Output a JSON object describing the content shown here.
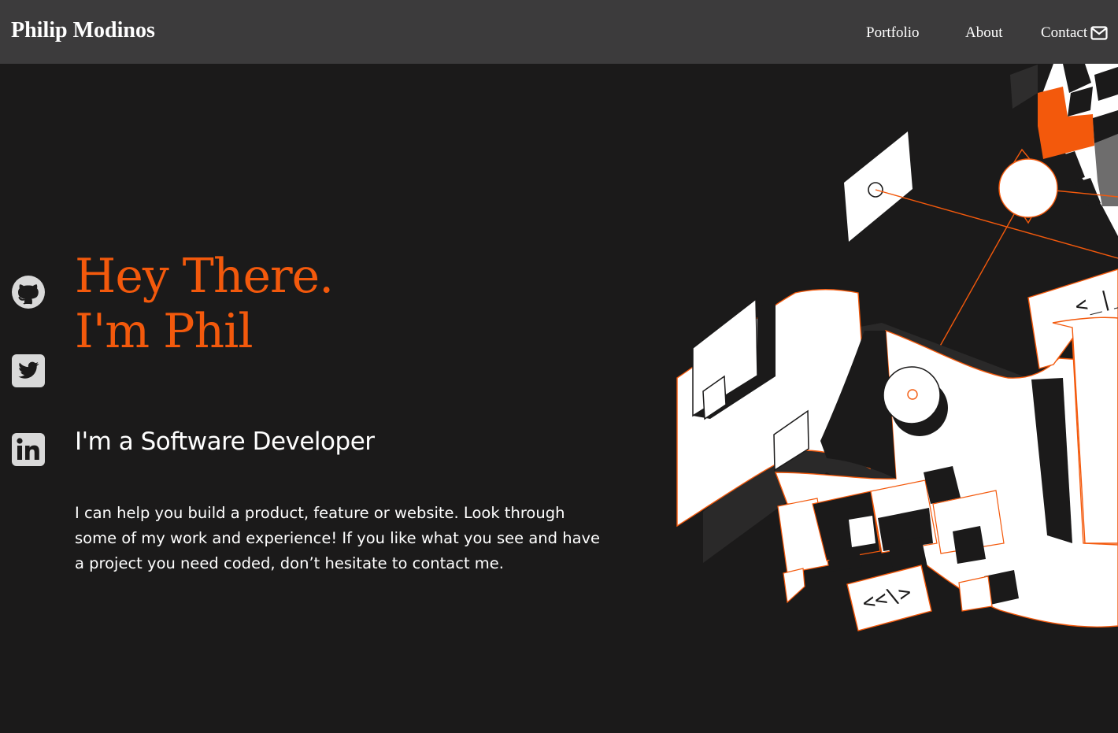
{
  "header": {
    "brand": "Philip Modinos",
    "nav": {
      "portfolio": "Portfolio",
      "about": "About",
      "contact": "Contact"
    },
    "contact_icon": "envelope-icon"
  },
  "social": [
    {
      "name": "github-icon"
    },
    {
      "name": "twitter-icon"
    },
    {
      "name": "linkedin-icon"
    }
  ],
  "hero": {
    "greeting_line1": "Hey There.",
    "greeting_line2": "I'm Phil",
    "subtitle": "I'm a Software Developer",
    "blurb": "I can help you build a product, feature or website. Look through some of my work and experience! If you like what you see and have a project you need coded, don’t hesitate to contact me.",
    "art_code_label_1": "<_|_",
    "art_code_label_2": "<<\\>"
  },
  "colors": {
    "background": "#1b1a1a",
    "navbar": "#3c3b3c",
    "accent": "#f3590c",
    "text": "#ffffff",
    "icon": "#d9d9d9"
  }
}
